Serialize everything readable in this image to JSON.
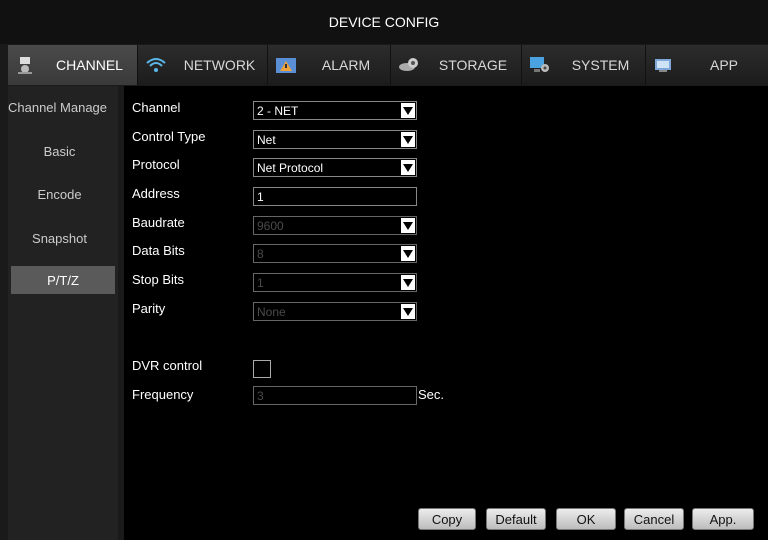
{
  "window": {
    "title": "DEVICE CONFIG"
  },
  "tabs": [
    {
      "label": "CHANNEL",
      "icon": "camera-icon",
      "active": true
    },
    {
      "label": "NETWORK",
      "icon": "wifi-icon"
    },
    {
      "label": "ALARM",
      "icon": "alarm-icon"
    },
    {
      "label": "STORAGE",
      "icon": "storage-icon"
    },
    {
      "label": "SYSTEM",
      "icon": "system-icon"
    },
    {
      "label": "APP",
      "icon": "app-icon"
    }
  ],
  "sidebar": {
    "items": [
      {
        "label": "Channel Manage"
      },
      {
        "label": "Basic"
      },
      {
        "label": "Encode"
      },
      {
        "label": "Snapshot"
      },
      {
        "label": "P/T/Z",
        "active": true
      }
    ]
  },
  "form": {
    "channel": {
      "label": "Channel",
      "value": "2 - NET"
    },
    "control_type": {
      "label": "Control Type",
      "value": "Net"
    },
    "protocol": {
      "label": "Protocol",
      "value": "Net Protocol"
    },
    "address": {
      "label": "Address",
      "value": "1"
    },
    "baudrate": {
      "label": "Baudrate",
      "value": "9600"
    },
    "data_bits": {
      "label": "Data Bits",
      "value": "8"
    },
    "stop_bits": {
      "label": "Stop Bits",
      "value": "1"
    },
    "parity": {
      "label": "Parity",
      "value": "None"
    },
    "dvr_control": {
      "label": "DVR control",
      "checked": false
    },
    "frequency": {
      "label": "Frequency",
      "value": "3",
      "unit": "Sec."
    }
  },
  "buttons": {
    "copy": "Copy",
    "default": "Default",
    "ok": "OK",
    "cancel": "Cancel",
    "apply": "App."
  }
}
